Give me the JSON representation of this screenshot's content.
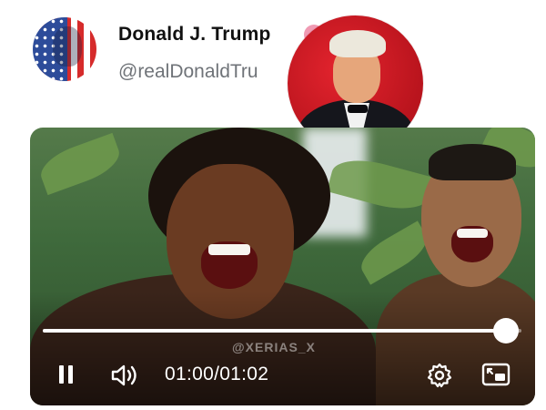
{
  "tweet": {
    "display_name": "Donald J. Trump",
    "handle": "@realDonaldTru"
  },
  "video": {
    "watermark": "@XERIAS_X",
    "current_time": "01:00",
    "separator": "/",
    "duration": "01:02",
    "progress_fraction": 0.968,
    "state": "playing"
  },
  "icons": {
    "verified_badge": "pink-flower-badge-icon",
    "pause": "pause-icon",
    "volume": "volume-icon",
    "settings": "gear-icon",
    "pip": "picture-in-picture-icon"
  },
  "colors": {
    "name": "#111111",
    "handle": "#6f7378",
    "badge": "#f09ab3",
    "controls": "#ffffff"
  }
}
